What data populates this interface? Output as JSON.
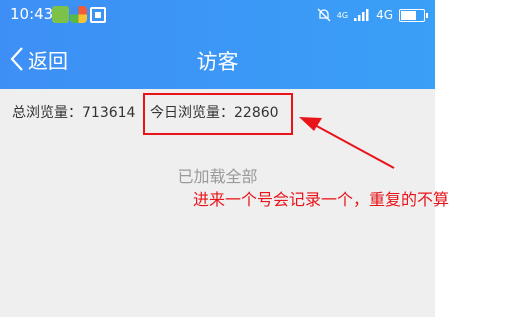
{
  "status_bar": {
    "time": "10:43",
    "network_sup": "4G",
    "network_label": "4G"
  },
  "nav": {
    "back_label": "返回",
    "title": "访客"
  },
  "stats": {
    "total_label": "总浏览量：",
    "total_value": "713614",
    "today_label": "今日浏览量：",
    "today_value": "22860"
  },
  "list": {
    "loaded_text": "已加载全部"
  },
  "annotation": {
    "text": "进来一个号会记录一个，重复的不算",
    "color": "#e8141a"
  },
  "colors": {
    "header": "#3d8ff5",
    "background": "#efefef"
  }
}
